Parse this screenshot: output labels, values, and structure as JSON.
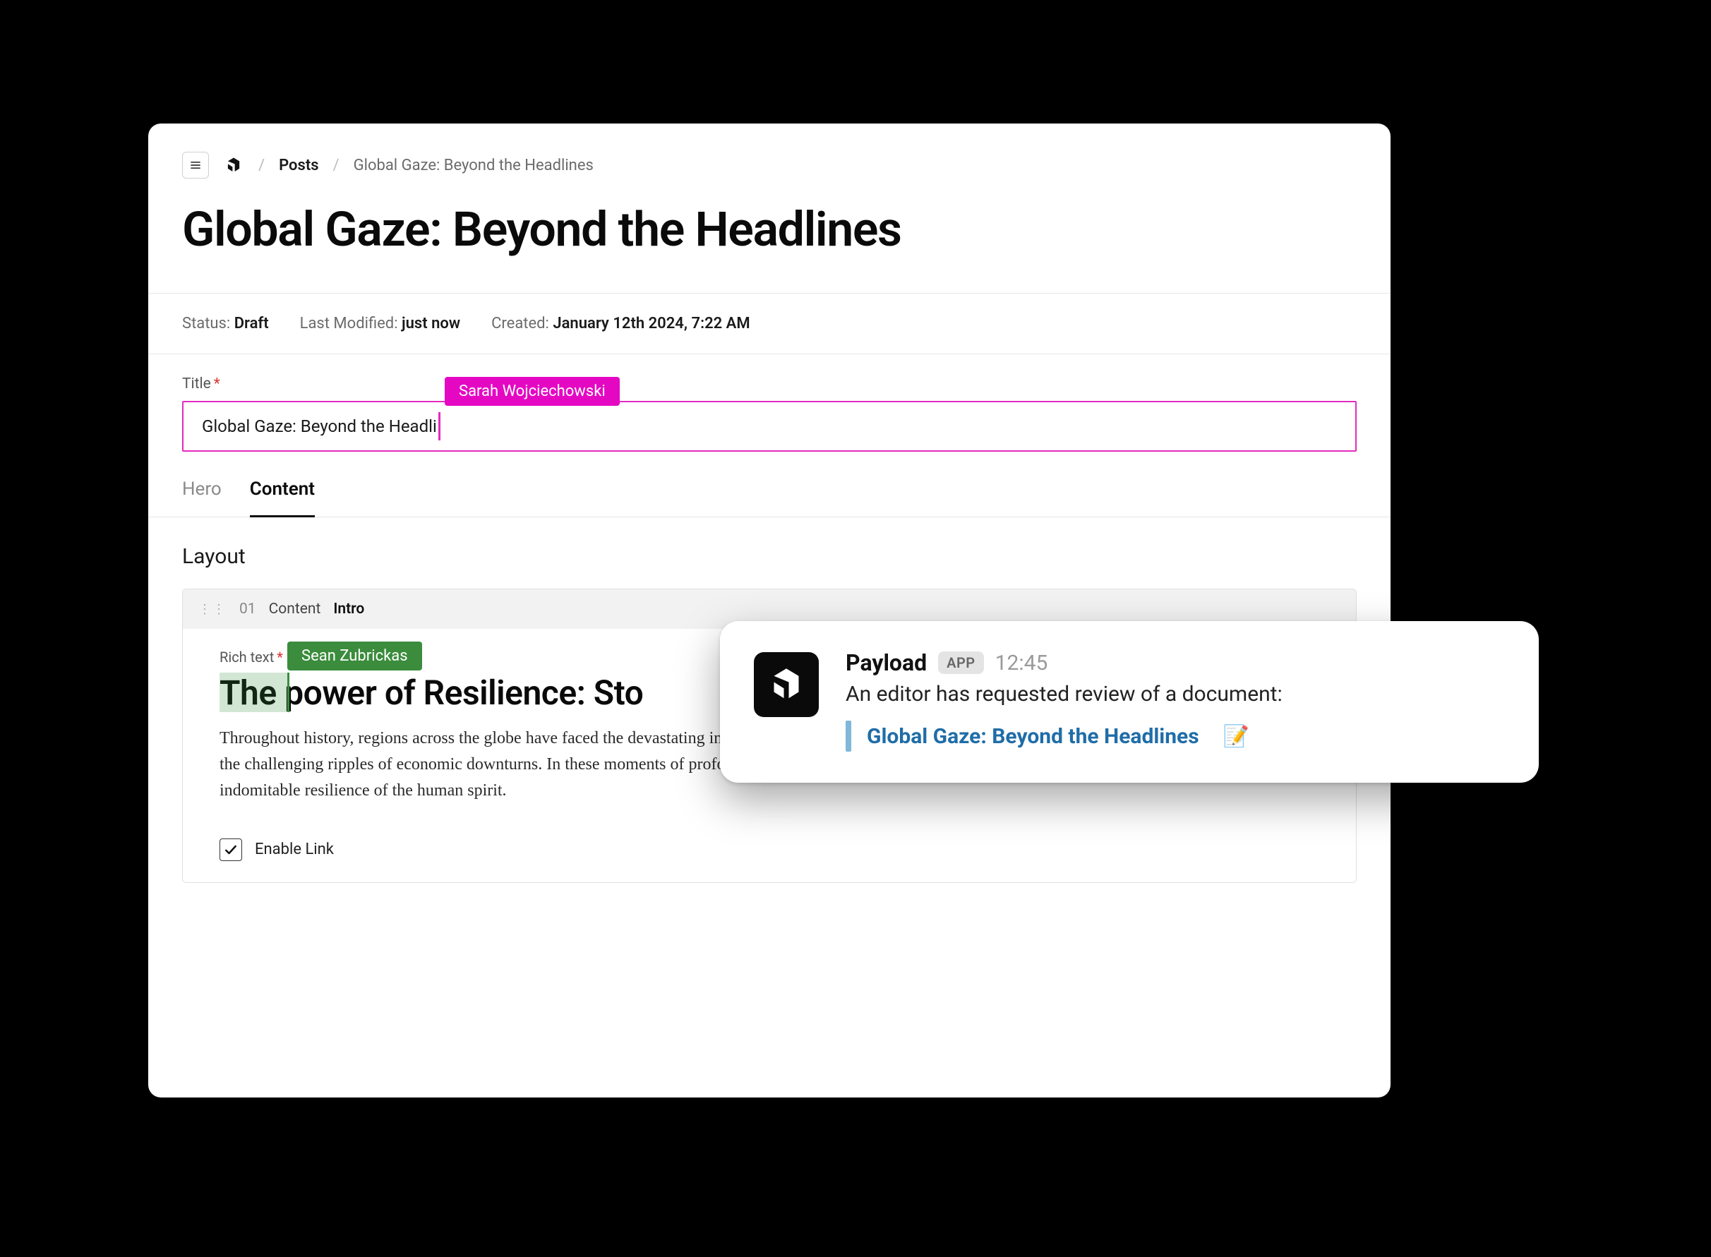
{
  "breadcrumbs": {
    "posts": "Posts",
    "current": "Global Gaze: Beyond the Headlines"
  },
  "page_title": "Global Gaze: Beyond the Headlines",
  "meta": {
    "status_label": "Status:",
    "status_value": "Draft",
    "modified_label": "Last Modified:",
    "modified_value": "just now",
    "created_label": "Created:",
    "created_value": "January 12th 2024, 7:22 AM"
  },
  "title_field": {
    "label": "Title",
    "value": "Global Gaze: Beyond the Headli",
    "collaborator": "Sarah Wojciechowski"
  },
  "tabs": {
    "hero": "Hero",
    "content": "Content"
  },
  "layout": {
    "heading": "Layout",
    "block": {
      "index": "01",
      "type": "Content",
      "name": "Intro",
      "rt_label": "Rich text",
      "rt_heading": "The power of Resilience: Sto",
      "rt_para": "Throughout history, regions across the globe have faced the devastating impact of natural disasters, the turbulence of political unrest, and the challenging ripples of economic downturns. In these moments of profound crisis, an often-underestimated force emerges: the indomitable resilience of the human spirit.",
      "collaborator": "Sean Zubrickas",
      "enable_link": "Enable Link"
    }
  },
  "toast": {
    "app_name": "Payload",
    "app_badge": "APP",
    "time": "12:45",
    "message": "An editor has requested review of a document:",
    "link_text": "Global Gaze: Beyond the Headlines",
    "emoji": "📝"
  }
}
